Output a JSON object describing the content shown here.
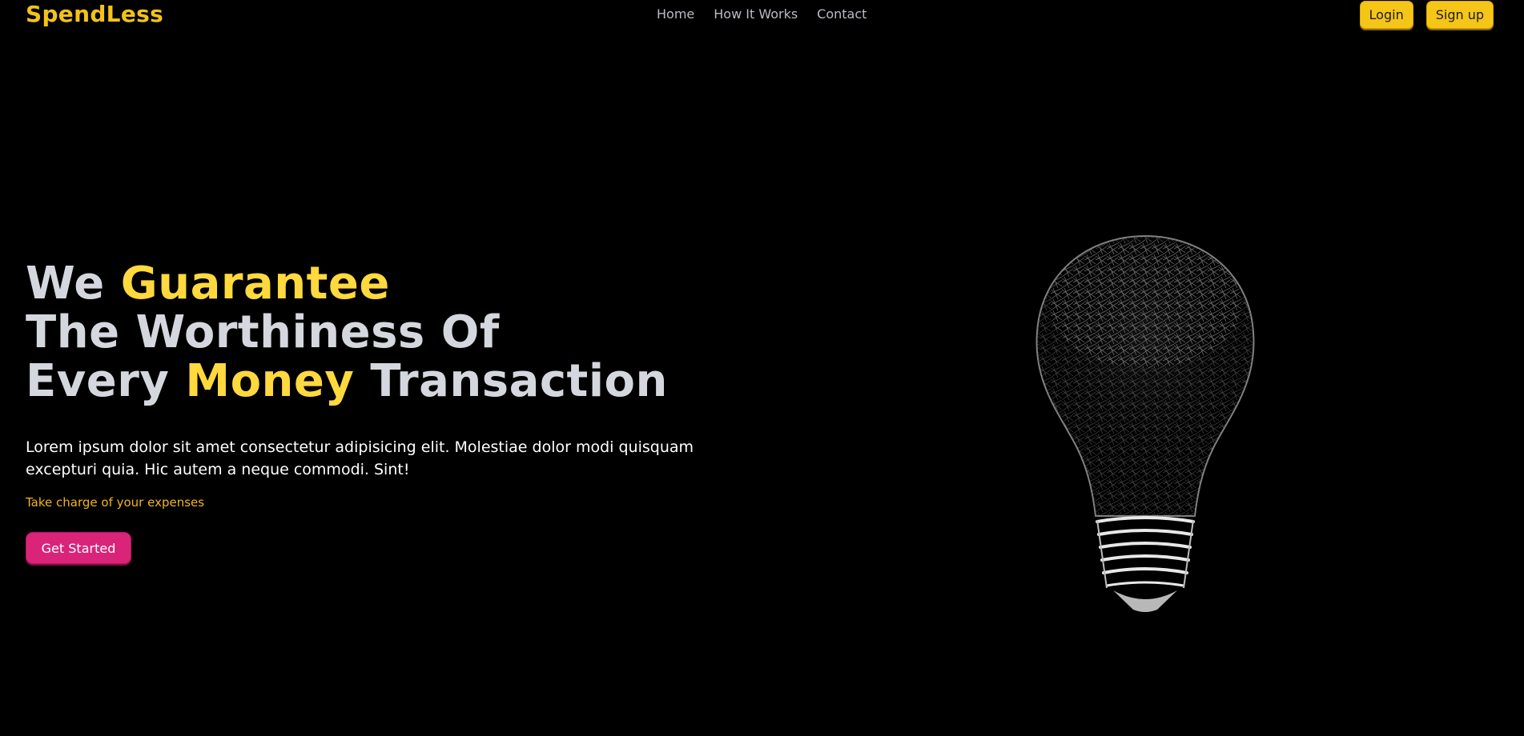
{
  "brand": {
    "name": "SpendLess"
  },
  "nav": {
    "links": [
      "Home",
      "How It Works",
      "Contact"
    ]
  },
  "auth": {
    "login_label": "Login",
    "signup_label": "Sign up"
  },
  "hero": {
    "title": {
      "line1_a": "We ",
      "line1_b": "Guarantee",
      "line2": "The Worthiness Of",
      "line3_a": "Every ",
      "line3_b": "Money",
      "line3_c": " Transaction"
    },
    "description": "Lorem ipsum dolor sit amet consectetur adipisicing elit. Molestiae dolor modi quisquam excepturi quia. Hic autem a neque commodi. Sint!",
    "tagline": "Take charge of your expenses",
    "cta_label": "Get Started"
  },
  "colors": {
    "background": "#000000",
    "accent_yellow": "#ffd93d",
    "brand_yellow": "#f2c318",
    "cta_pink": "#d9247a",
    "nav_text": "#b9bcc6"
  },
  "illustration": {
    "icon": "lightbulb-icon"
  }
}
